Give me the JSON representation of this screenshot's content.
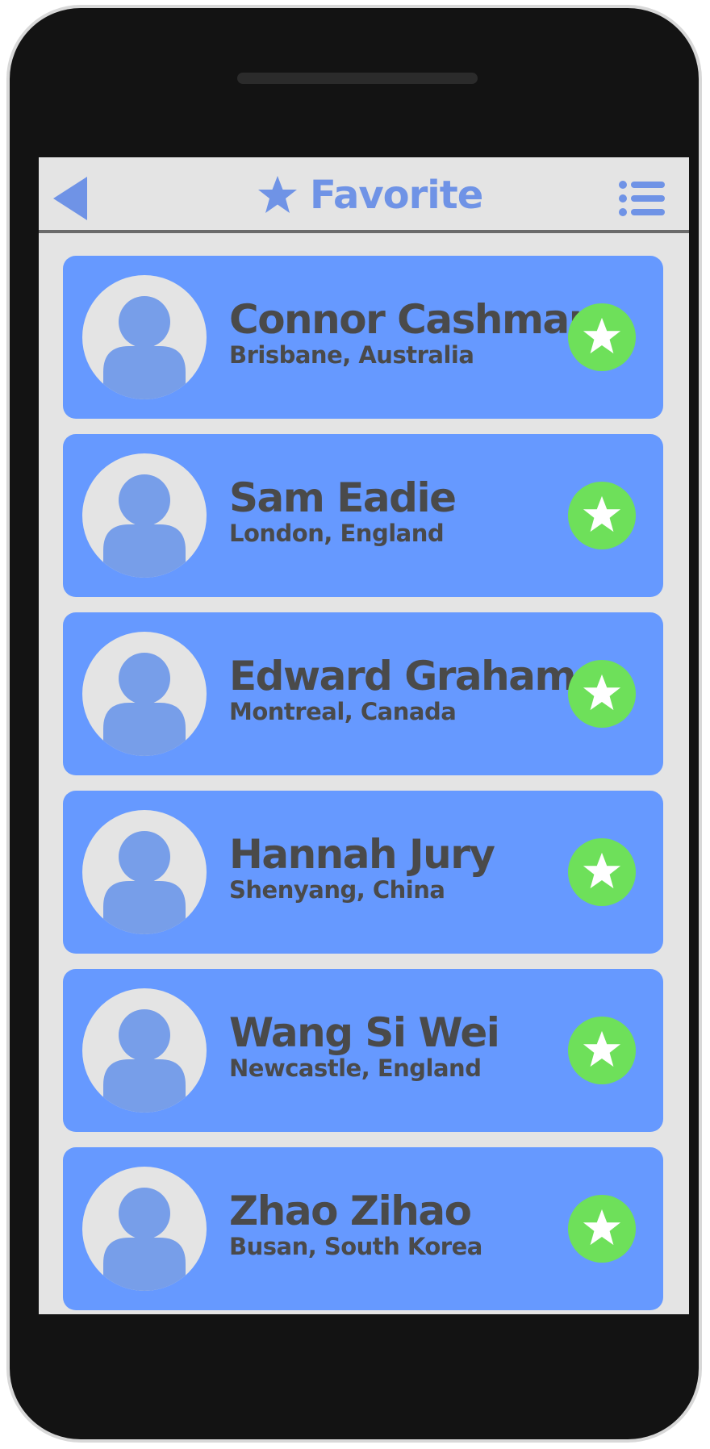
{
  "header": {
    "title": "Favorite",
    "back_icon": "back-arrow-icon",
    "title_icon": "star-icon",
    "menu_icon": "list-menu-icon"
  },
  "colors": {
    "accent": "#6f93e6",
    "card": "#6699ff",
    "favorite": "#6ee05a",
    "screen_bg": "#e4e4e4",
    "text": "#4a4a4a"
  },
  "contacts": [
    {
      "name": "Connor Cashman",
      "location": "Brisbane, Australia",
      "favorite_icon": "star-icon"
    },
    {
      "name": "Sam Eadie",
      "location": "London, England",
      "favorite_icon": "star-icon"
    },
    {
      "name": "Edward Graham",
      "location": "Montreal, Canada",
      "favorite_icon": "star-icon"
    },
    {
      "name": "Hannah Jury",
      "location": "Shenyang, China",
      "favorite_icon": "star-icon"
    },
    {
      "name": "Wang Si Wei",
      "location": "Newcastle, England",
      "favorite_icon": "star-icon"
    },
    {
      "name": "Zhao Zihao",
      "location": "Busan, South Korea",
      "favorite_icon": "star-icon"
    }
  ]
}
